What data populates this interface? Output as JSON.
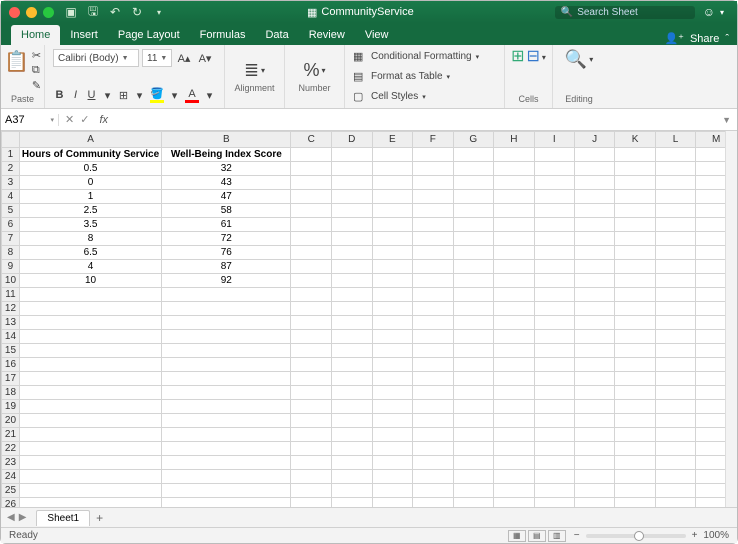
{
  "titlebar": {
    "filename": "CommunityService",
    "search_placeholder": "Search Sheet"
  },
  "tabs": {
    "items": [
      "Home",
      "Insert",
      "Page Layout",
      "Formulas",
      "Data",
      "Review",
      "View"
    ],
    "active": 0,
    "share": "Share"
  },
  "ribbon": {
    "paste": "Paste",
    "font_name": "Calibri (Body)",
    "font_size": "11",
    "alignment": "Alignment",
    "number": "Number",
    "cond_fmt": "Conditional Formatting",
    "fmt_table": "Format as Table",
    "cell_styles": "Cell Styles",
    "cells": "Cells",
    "editing": "Editing"
  },
  "formula_bar": {
    "cell_ref": "A37",
    "formula": ""
  },
  "columns": [
    "A",
    "B",
    "C",
    "D",
    "E",
    "F",
    "G",
    "H",
    "I",
    "J",
    "K",
    "L",
    "M"
  ],
  "headers": [
    "Hours of Community Service",
    "Well-Being Index Score"
  ],
  "rows": [
    [
      "0.5",
      "32"
    ],
    [
      "0",
      "43"
    ],
    [
      "1",
      "47"
    ],
    [
      "2.5",
      "58"
    ],
    [
      "3.5",
      "61"
    ],
    [
      "8",
      "72"
    ],
    [
      "6.5",
      "76"
    ],
    [
      "4",
      "87"
    ],
    [
      "10",
      "92"
    ]
  ],
  "total_rows": 27,
  "sheet": {
    "name": "Sheet1"
  },
  "status": {
    "ready": "Ready",
    "zoom": "100%"
  }
}
